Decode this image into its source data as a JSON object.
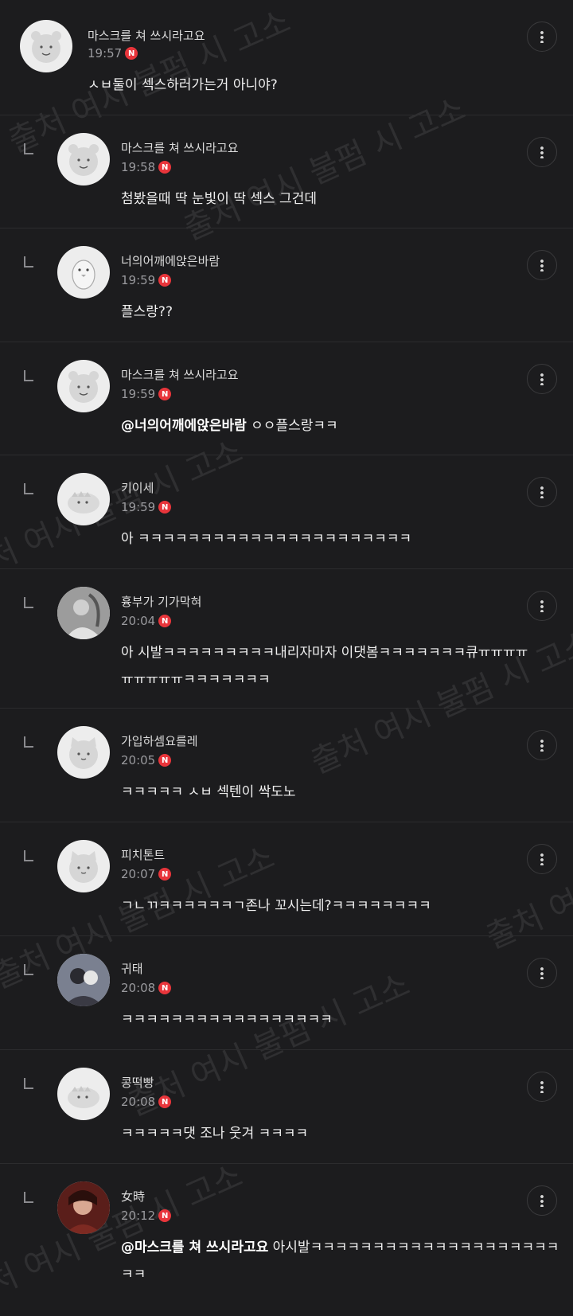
{
  "watermark_text": "출처 여시 불펌 시 고소",
  "badge_label": "N",
  "comments": [
    {
      "nick": "마스크를 쳐 쓰시라고요",
      "time": "19:57",
      "line1": "ㅅㅂ둘이 섹스하러가는거 아니야?",
      "line2": "",
      "mention": "",
      "avatar": "bear-icon"
    },
    {
      "nick": "마스크를 쳐 쓰시라고요",
      "time": "19:58",
      "line1": "첨봤을때 딱 눈빛이 딱 섹스 그건데",
      "line2": "",
      "mention": "",
      "avatar": "bear-icon"
    },
    {
      "nick": "너의어깨에앉은바람",
      "time": "19:59",
      "line1": "플스랑??",
      "line2": "",
      "mention": "",
      "avatar": "bird-icon"
    },
    {
      "nick": "마스크를 쳐 쓰시라고요",
      "time": "19:59",
      "line1": "ㅇㅇ플스랑ㅋㅋ",
      "line2": "",
      "mention": "@너의어깨에앉은바람",
      "avatar": "bear-icon"
    },
    {
      "nick": "키이세",
      "time": "19:59",
      "line1": "아 ㅋㅋㅋㅋㅋㅋㅋㅋㅋㅋㅋㅋㅋㅋㅋㅋㅋㅋㅋㅋㅋㅋ",
      "line2": "",
      "mention": "",
      "avatar": "dino-icon"
    },
    {
      "nick": "흉부가 기가막혀",
      "time": "20:04",
      "line1": "아 시발ㅋㅋㅋㅋㅋㅋㅋㅋㅋ내리자마자 이댓봄ㅋㅋㅋㅋㅋㅋㅋ큐ㅠㅠㅠㅠ",
      "line2": "ㅠㅠㅠㅠㅠㅋㅋㅋㅋㅋㅋㅋ",
      "mention": "",
      "avatar": "photo-icon"
    },
    {
      "nick": "가입하셈요를레",
      "time": "20:05",
      "line1": "ㅋㅋㅋㅋㅋ ㅅㅂ 섹텐이 싹도노",
      "line2": "",
      "mention": "",
      "avatar": "cat-icon"
    },
    {
      "nick": "피치톤트",
      "time": "20:07",
      "line1": "ㄱㄴㄲㅋㅋㅋㅋㅋㅋㄱ존나 꼬시는데?ㅋㅋㅋㅋㅋㅋㅋㅋ",
      "line2": "",
      "mention": "",
      "avatar": "cat-icon"
    },
    {
      "nick": "귀태",
      "time": "20:08",
      "line1": "ㅋㅋㅋㅋㅋㅋㅋㅋㅋㅋㅋㅋㅋㅋㅋㅋㅋ",
      "line2": "",
      "mention": "",
      "avatar": "photo-icon"
    },
    {
      "nick": "콩떡빵",
      "time": "20:08",
      "line1": "ㅋㅋㅋㅋㅋ댓 조나 웃겨 ㅋㅋㅋㅋ",
      "line2": "",
      "mention": "",
      "avatar": "dino-icon"
    },
    {
      "nick": "女時",
      "time": "20:12",
      "line1": "아시발ㅋㅋㅋㅋㅋㅋㅋㅋㅋㅋㅋㅋㅋㅋㅋㅋㅋㅋㅋㅋ",
      "line2": "ㅋㅋ",
      "mention": "@마스크를 쳐 쓰시라고요",
      "avatar": "photo-icon"
    }
  ]
}
